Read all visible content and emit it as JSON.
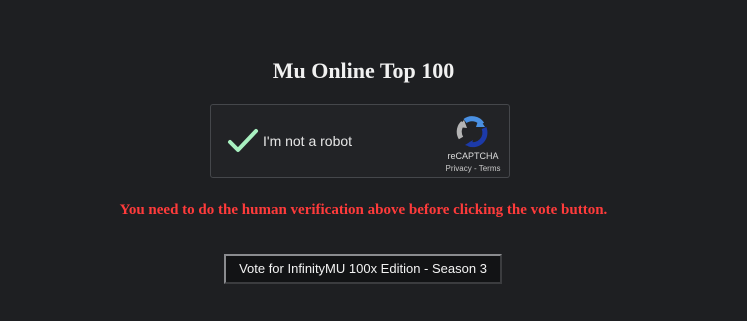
{
  "page": {
    "title": "Mu Online Top 100"
  },
  "recaptcha": {
    "checkbox_state": "checked",
    "label": "I'm not a robot",
    "brand": "reCAPTCHA",
    "privacy_link": "Privacy",
    "separator": " - ",
    "terms_link": "Terms",
    "check_icon": "checkmark-icon",
    "logo_icon": "recaptcha-logo-icon",
    "colors": {
      "checkmark": "#a8f0c0",
      "logo_blue": "#4a90e2",
      "logo_dark_blue": "#1c3aa9",
      "logo_gray": "#b4b4b4"
    }
  },
  "warning": {
    "text": "You need to do the human verification above before clicking the vote button.",
    "color": "#ff3b3b"
  },
  "vote": {
    "button_label": "Vote for InfinityMU 100x Edition - Season 3"
  }
}
